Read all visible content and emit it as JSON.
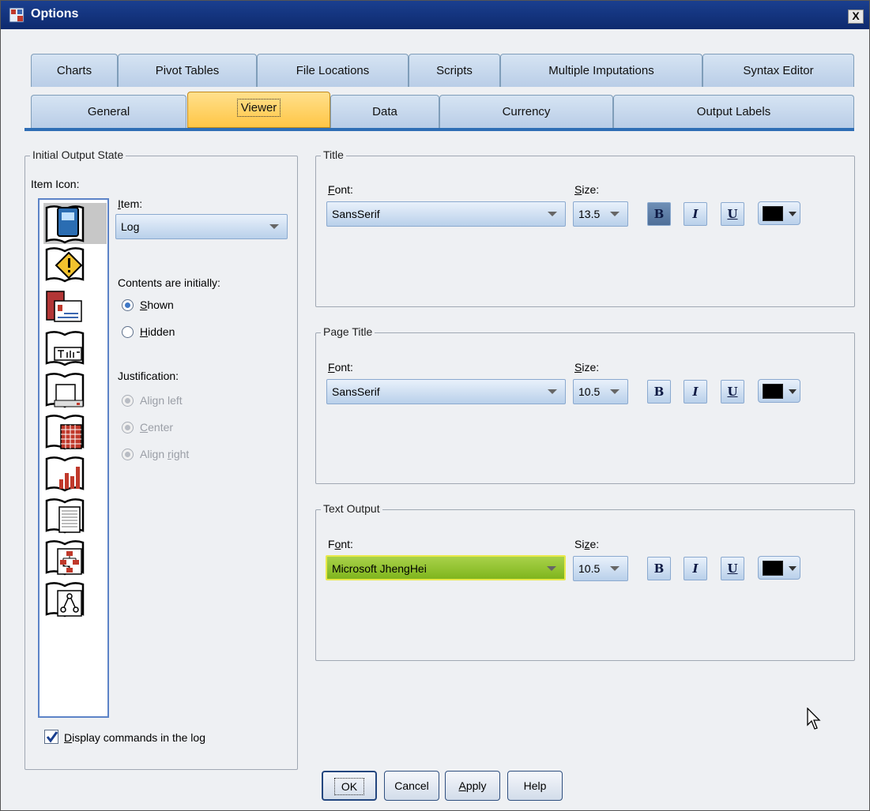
{
  "window": {
    "title": "Options",
    "close_label": "X"
  },
  "tabs_row1": [
    "Charts",
    "Pivot Tables",
    "File Locations",
    "Scripts",
    "Multiple Imputations",
    "Syntax Editor"
  ],
  "tabs_row2": [
    "General",
    "Viewer",
    "Data",
    "Currency",
    "Output Labels"
  ],
  "active_tab": "Viewer",
  "initial_output_state": {
    "group_title": "Initial Output State",
    "item_icon_label": "Item Icon:",
    "item_label": "Item:",
    "item_value": "Log",
    "contents_label": "Contents are initially:",
    "contents_options": [
      "Shown",
      "Hidden"
    ],
    "contents_selected": "Shown",
    "justification_label": "Justification:",
    "justification_options": [
      "Align left",
      "Center",
      "Align right"
    ],
    "justification_selected": "Align left",
    "display_commands_label": "Display commands in the log",
    "display_commands_checked": true
  },
  "title_group": {
    "group_title": "Title",
    "font_label": "Font:",
    "font_value": "SansSerif",
    "size_label": "Size:",
    "size_value": "13.5",
    "bold_pressed": true
  },
  "page_title_group": {
    "group_title": "Page Title",
    "font_label": "Font:",
    "font_value": "SansSerif",
    "size_label": "Size:",
    "size_value": "10.5"
  },
  "text_output_group": {
    "group_title": "Text Output",
    "font_label": "Font:",
    "font_value": "Microsoft JhengHei",
    "size_label": "Size:",
    "size_value": "10.5"
  },
  "style_buttons": {
    "bold": "B",
    "italic": "I",
    "underline": "U"
  },
  "buttons": {
    "ok": "OK",
    "cancel": "Cancel",
    "apply": "Apply",
    "help": "Help"
  },
  "colors": {
    "accent": "#2f6eb5",
    "active_tab": "#ffc646",
    "highlight_select": "#8cc030",
    "font_color": "#000000"
  }
}
